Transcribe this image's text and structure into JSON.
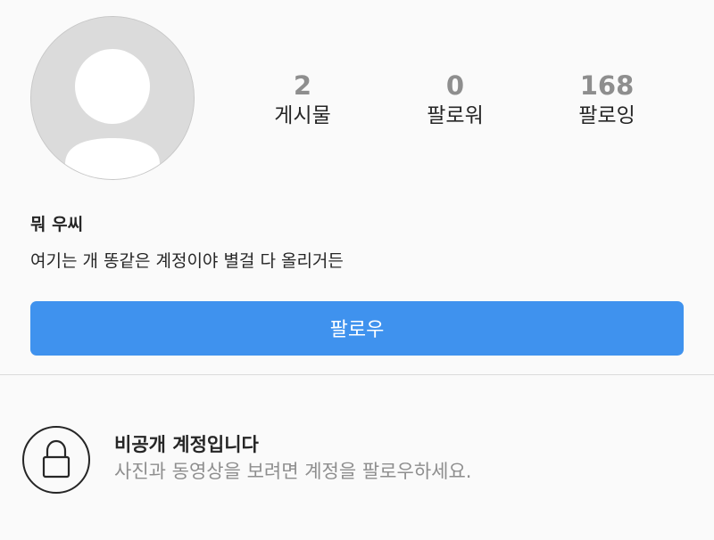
{
  "profile": {
    "name": "뭐 우씨",
    "bio": "여기는 개 똥같은 계정이야 별걸 다 올리거든",
    "avatar_icon": "default-avatar-icon"
  },
  "stats": {
    "posts": {
      "value": "2",
      "label": "게시물"
    },
    "followers": {
      "value": "0",
      "label": "팔로워"
    },
    "following": {
      "value": "168",
      "label": "팔로잉"
    }
  },
  "follow_button": {
    "label": "팔로우",
    "color": "#3f92ee"
  },
  "private_notice": {
    "icon": "lock-icon",
    "title": "비공개 계정입니다",
    "description": "사진과 동영상을 보려면 계정을 팔로우하세요."
  }
}
